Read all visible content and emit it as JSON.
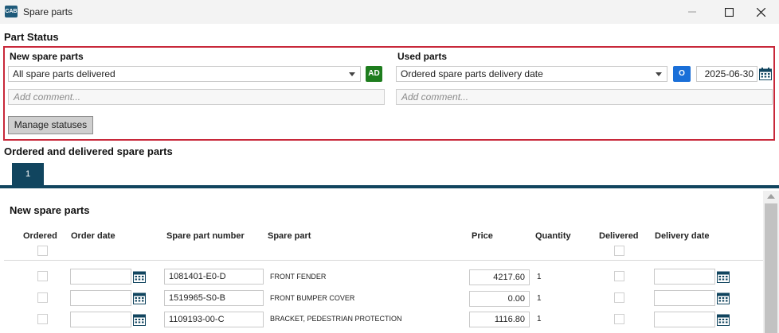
{
  "window": {
    "title": "Spare parts",
    "app_icon_text": "CAB",
    "minimize_icon": "minimize-icon",
    "maximize_icon": "maximize-icon",
    "close_icon": "close-icon"
  },
  "part_status": {
    "title": "Part Status",
    "highlight_color": "#c8283a",
    "new_parts": {
      "label": "New spare parts",
      "selected": "All spare parts delivered",
      "badge": "AD",
      "badge_color": "#1e7d1e",
      "comment_placeholder": "Add comment..."
    },
    "used_parts": {
      "label": "Used parts",
      "selected": "Ordered spare parts delivery date",
      "badge": "O",
      "badge_color": "#1a6fd8",
      "date": "2025-06-30",
      "comment_placeholder": "Add comment..."
    },
    "manage_button": "Manage statuses"
  },
  "ordered_section": {
    "title": "Ordered and delivered spare parts",
    "tabs": [
      "1"
    ],
    "tab_color": "#11455f"
  },
  "table": {
    "title": "New spare parts",
    "columns": {
      "ordered": "Ordered",
      "order_date": "Order date",
      "part_number": "Spare part number",
      "part_name": "Spare part",
      "price": "Price",
      "quantity": "Quantity",
      "delivered": "Delivered",
      "delivery_date": "Delivery date"
    },
    "rows": [
      {
        "part_number": "1081401-E0-D",
        "part_name": "FRONT FENDER",
        "price": "4217.60",
        "quantity": "1"
      },
      {
        "part_number": "1519965-S0-B",
        "part_name": "FRONT BUMPER COVER",
        "price": "0.00",
        "quantity": "1"
      },
      {
        "part_number": "1109193-00-C",
        "part_name": "BRACKET, PEDESTRIAN PROTECTION",
        "price": "1116.80",
        "quantity": "1"
      }
    ]
  }
}
